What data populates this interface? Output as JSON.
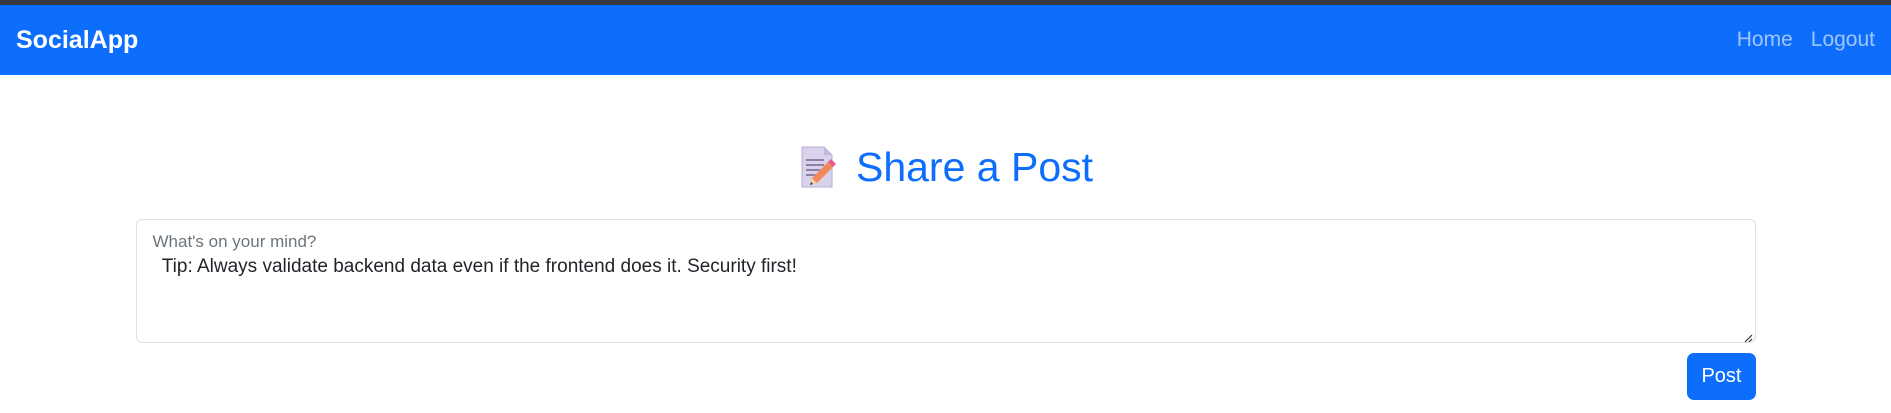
{
  "navbar": {
    "brand": "SocialApp",
    "links": [
      {
        "label": "Home"
      },
      {
        "label": "Logout"
      }
    ],
    "color": "#0d6efd"
  },
  "main": {
    "title_icon": "memo-icon",
    "title": "Share a Post",
    "composer": {
      "label": "What's on your mind?",
      "value": " Tip: Always validate backend data even if the frontend does it. Security first!"
    },
    "post_button": "Post"
  }
}
